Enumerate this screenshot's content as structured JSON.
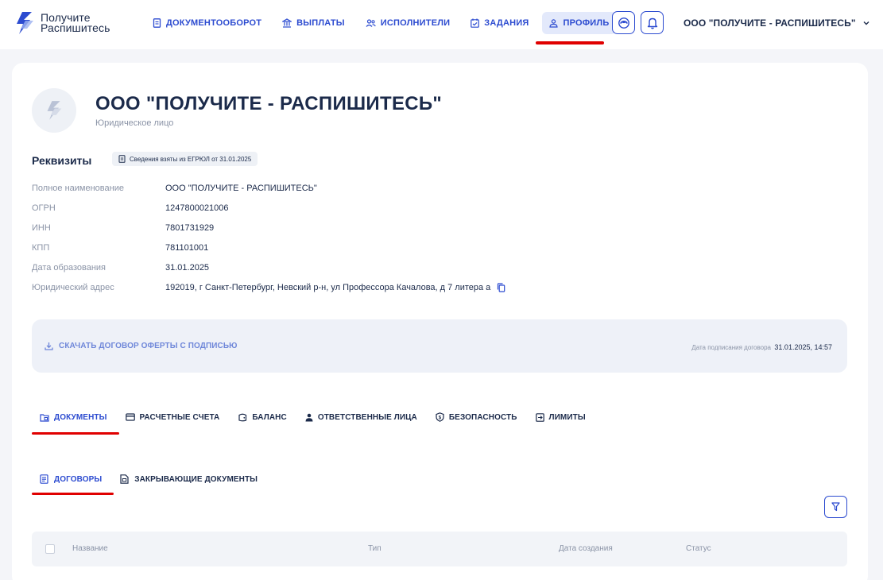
{
  "brand": {
    "line1": "Получите",
    "line2": "Распишитесь",
    "accent": "#2c4bd0"
  },
  "nav": [
    {
      "label": "ДОКУМЕНТООБОРОТ",
      "icon": "document-icon"
    },
    {
      "label": "ВЫПЛАТЫ",
      "icon": "bank-icon"
    },
    {
      "label": "ИСПОЛНИТЕЛИ",
      "icon": "people-icon"
    },
    {
      "label": "ЗАДАНИЯ",
      "icon": "calendar-check-icon"
    },
    {
      "label": "ПРОФИЛЬ",
      "icon": "user-icon",
      "active": true
    }
  ],
  "header": {
    "support_icon": "support-chat-icon",
    "notifications_icon": "bell-icon",
    "org_selector": "ООО \"ПОЛУЧИТЕ - РАСПИШИТЕСЬ\""
  },
  "company": {
    "name": "ООО \"ПОЛУЧИТЕ - РАСПИШИТЕСЬ\"",
    "type": "Юридическое лицо"
  },
  "requisites": {
    "title": "Реквизиты",
    "source_badge": "Сведения взяты из ЕГРЮЛ от 31.01.2025",
    "rows": [
      {
        "label": "Полное наименование",
        "value": "ООО \"ПОЛУЧИТЕ - РАСПИШИТЕСЬ\""
      },
      {
        "label": "ОГРН",
        "value": "1247800021006"
      },
      {
        "label": "ИНН",
        "value": "7801731929"
      },
      {
        "label": "КПП",
        "value": "781101001"
      },
      {
        "label": "Дата образования",
        "value": "31.01.2025"
      },
      {
        "label": "Юридический адрес",
        "value": "192019, г Санкт-Петербург, Невский р-н, ул Профессора Качалова, д 7 литера а"
      }
    ]
  },
  "offer": {
    "download_label": "СКАЧАТЬ ДОГОВОР ОФЕРТЫ С ПОДПИСЬЮ",
    "date_label": "Дата подписания договора",
    "date_value": "31.01.2025, 14:57"
  },
  "tabs": [
    {
      "label": "ДОКУМЕНТЫ",
      "icon": "folder-icon",
      "active": true
    },
    {
      "label": "РАСЧЕТНЫЕ СЧЕТА",
      "icon": "card-icon"
    },
    {
      "label": "БАЛАНС",
      "icon": "wallet-icon"
    },
    {
      "label": "ОТВЕТСТВЕННЫЕ ЛИЦА",
      "icon": "person-icon"
    },
    {
      "label": "БЕЗОПАСНОСТЬ",
      "icon": "shield-icon"
    },
    {
      "label": "ЛИМИТЫ",
      "icon": "limits-icon"
    }
  ],
  "subtabs": [
    {
      "label": "ДОГОВОРЫ",
      "icon": "contract-icon",
      "active": true
    },
    {
      "label": "ЗАКРЫВАЮЩИЕ ДОКУМЕНТЫ",
      "icon": "closing-docs-icon"
    }
  ],
  "table": {
    "columns": [
      "Название",
      "Тип",
      "Дата создания",
      "Статус"
    ]
  }
}
